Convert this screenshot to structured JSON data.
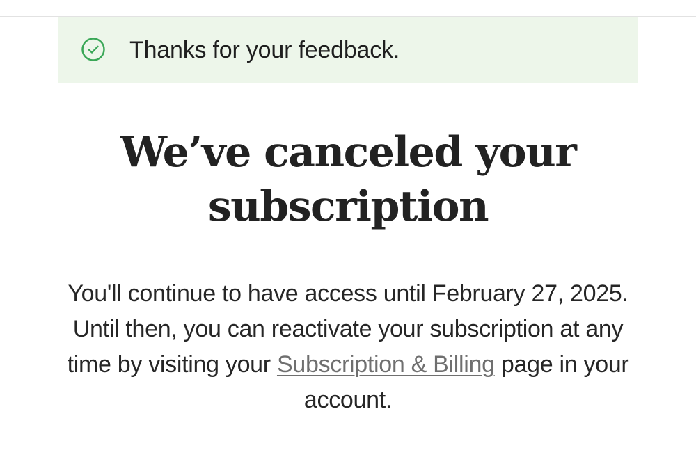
{
  "toast": {
    "icon": "check-circle-icon",
    "message": "Thanks for your feedback.",
    "background_color": "#edf6ea",
    "icon_color": "#3aa757"
  },
  "headline": {
    "line1": "We’ve canceled your",
    "line2": "subscription"
  },
  "body": {
    "text_before_link": "You'll continue to have access until February 27, 2025. Until then, you can reactivate your subscription at any time by visiting your ",
    "link_label": "Subscription & Billing",
    "text_after_link": " page in your account."
  }
}
